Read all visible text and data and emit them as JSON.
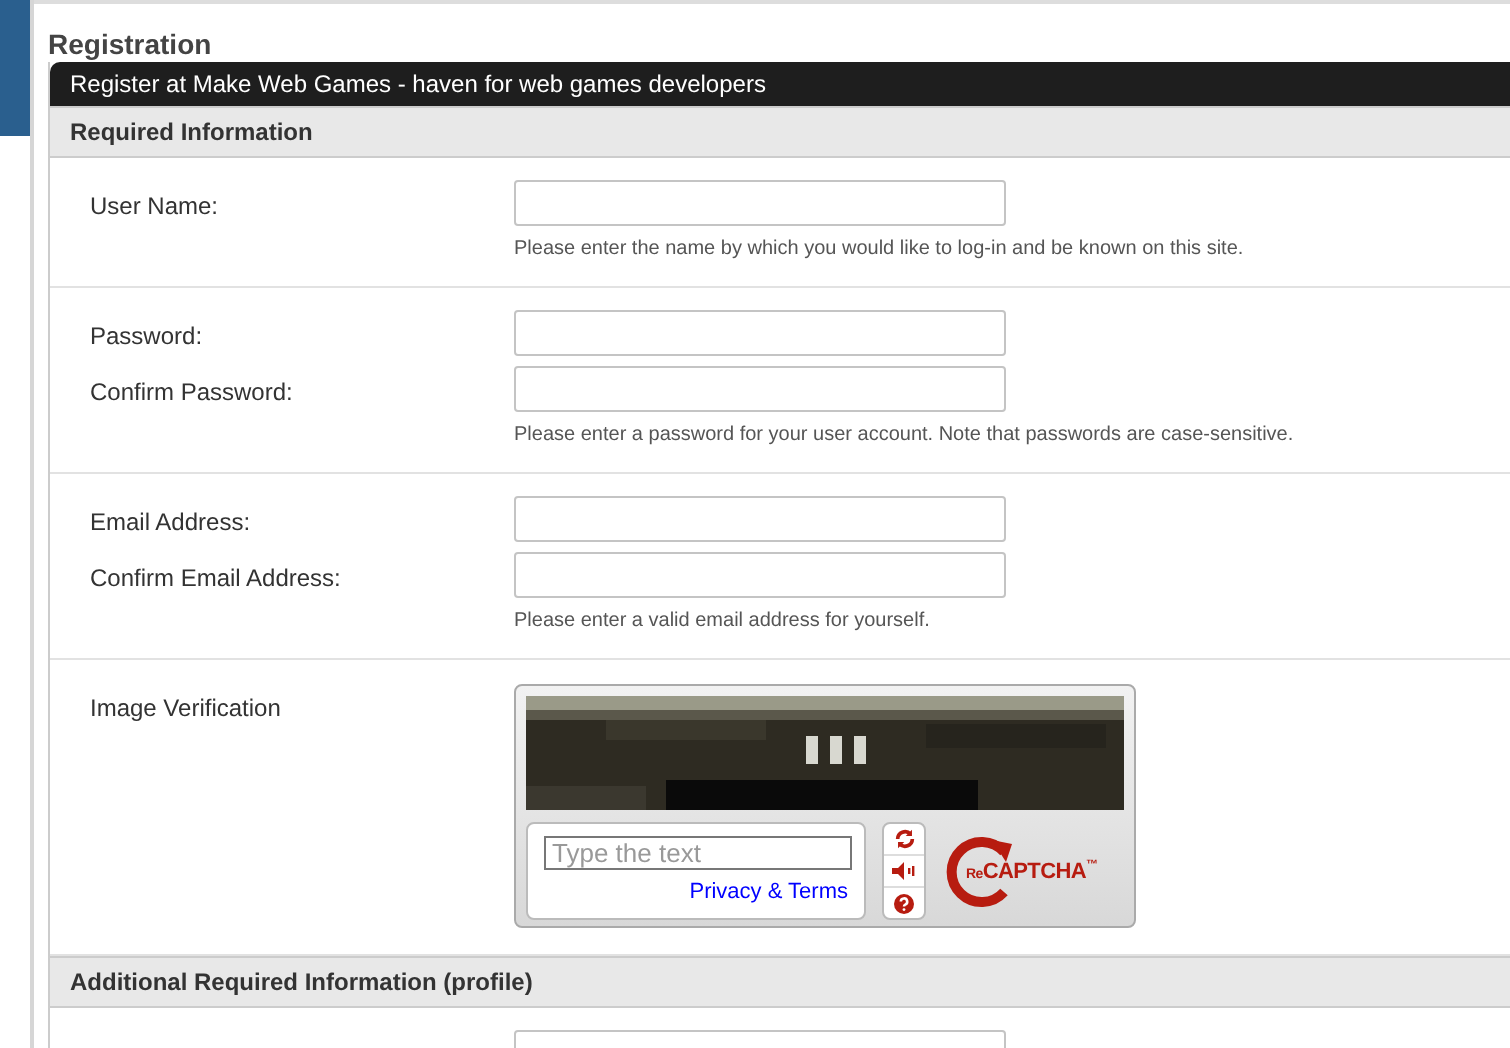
{
  "page_title": "Registration",
  "form": {
    "title": "Register at Make Web Games - haven for web games developers",
    "sections": [
      {
        "title": "Required Information",
        "groups": [
          {
            "kind": "fields",
            "fields": [
              {
                "label": "User Name:"
              }
            ],
            "hint": "Please enter the name by which you would like to log-in and be known on this site."
          },
          {
            "kind": "fields",
            "fields": [
              {
                "label": "Password:"
              },
              {
                "label": "Confirm Password:"
              }
            ],
            "hint": "Please enter a password for your user account. Note that passwords are case-sensitive."
          },
          {
            "kind": "fields",
            "fields": [
              {
                "label": "Email Address:"
              },
              {
                "label": "Confirm Email Address:"
              }
            ],
            "hint": "Please enter a valid email address for yourself."
          },
          {
            "kind": "captcha",
            "label": "Image Verification",
            "captcha": {
              "placeholder": "Type the text",
              "link": "Privacy & Terms",
              "brand_prefix": "Re",
              "brand": "CAPTCHA",
              "trademark": "™"
            }
          }
        ]
      },
      {
        "title": "Additional Required Information (profile)",
        "groups": [
          {
            "kind": "unlabeled_field"
          }
        ]
      }
    ]
  }
}
